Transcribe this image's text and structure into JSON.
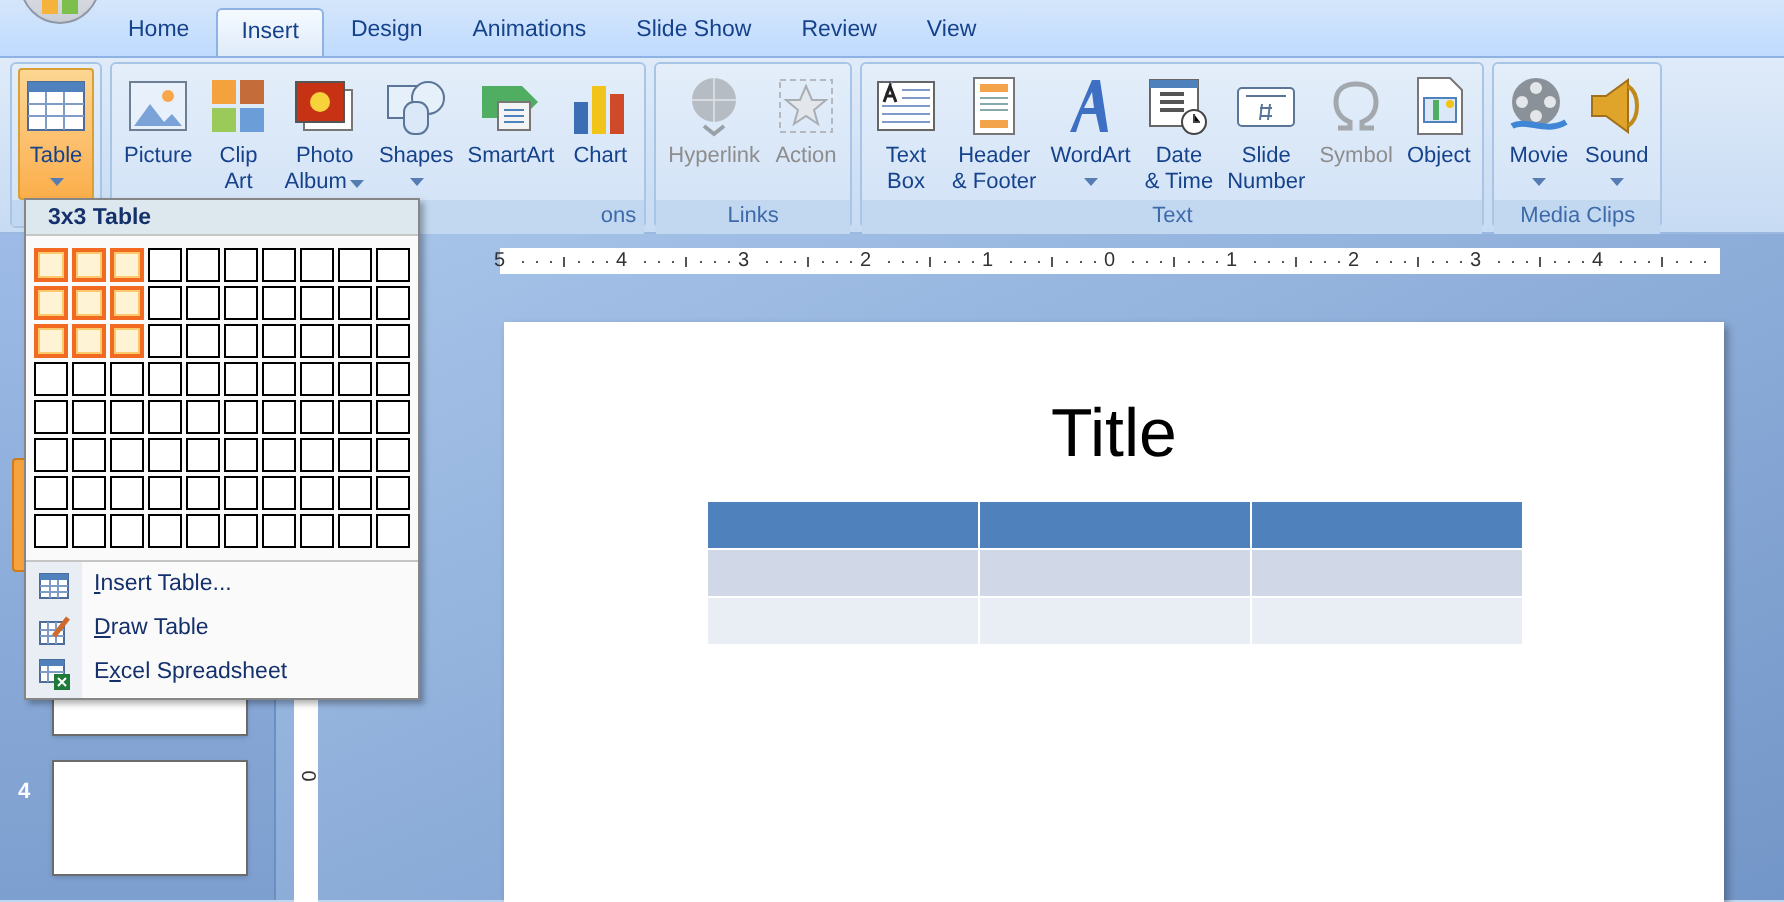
{
  "tabs": [
    {
      "label": "Home",
      "selected": false
    },
    {
      "label": "Insert",
      "selected": true
    },
    {
      "label": "Design",
      "selected": false
    },
    {
      "label": "Animations",
      "selected": false
    },
    {
      "label": "Slide Show",
      "selected": false
    },
    {
      "label": "Review",
      "selected": false
    },
    {
      "label": "View",
      "selected": false
    }
  ],
  "ribbon": {
    "groups": [
      {
        "buttons": [
          {
            "lines": [
              "Table"
            ],
            "dropdown": true,
            "disabled": false,
            "selected": true
          }
        ]
      },
      {
        "label": "ons",
        "buttons": [
          {
            "lines": [
              "Picture"
            ],
            "dropdown": false,
            "disabled": false,
            "selected": false
          },
          {
            "lines": [
              "Clip",
              "Art"
            ],
            "dropdown": false,
            "disabled": false,
            "selected": false
          },
          {
            "lines": [
              "Photo",
              "Album"
            ],
            "dropdown": true,
            "disabled": false,
            "selected": false
          },
          {
            "lines": [
              "Shapes"
            ],
            "dropdown": true,
            "disabled": false,
            "selected": false
          },
          {
            "lines": [
              "SmartArt"
            ],
            "dropdown": false,
            "disabled": false,
            "selected": false
          },
          {
            "lines": [
              "Chart"
            ],
            "dropdown": false,
            "disabled": false,
            "selected": false
          }
        ]
      },
      {
        "label": "Links",
        "buttons": [
          {
            "lines": [
              "Hyperlink"
            ],
            "dropdown": false,
            "disabled": true,
            "selected": false
          },
          {
            "lines": [
              "Action"
            ],
            "dropdown": false,
            "disabled": true,
            "selected": false
          }
        ]
      },
      {
        "label": "Text",
        "buttons": [
          {
            "lines": [
              "Text",
              "Box"
            ],
            "dropdown": false,
            "disabled": false,
            "selected": false
          },
          {
            "lines": [
              "Header",
              "& Footer"
            ],
            "dropdown": false,
            "disabled": false,
            "selected": false
          },
          {
            "lines": [
              "WordArt"
            ],
            "dropdown": true,
            "disabled": false,
            "selected": false
          },
          {
            "lines": [
              "Date",
              "& Time"
            ],
            "dropdown": false,
            "disabled": false,
            "selected": false
          },
          {
            "lines": [
              "Slide",
              "Number"
            ],
            "dropdown": false,
            "disabled": false,
            "selected": false
          },
          {
            "lines": [
              "Symbol"
            ],
            "dropdown": false,
            "disabled": true,
            "selected": false
          },
          {
            "lines": [
              "Object"
            ],
            "dropdown": false,
            "disabled": false,
            "selected": false
          }
        ]
      },
      {
        "label": "Media Clips",
        "buttons": [
          {
            "lines": [
              "Movie"
            ],
            "dropdown": true,
            "disabled": false,
            "selected": false
          },
          {
            "lines": [
              "Sound"
            ],
            "dropdown": true,
            "disabled": false,
            "selected": false
          }
        ]
      }
    ]
  },
  "table_menu": {
    "header": "3x3 Table",
    "grid": [
      {
        "cells": [
          {
            "selected": true
          },
          {
            "selected": true
          },
          {
            "selected": true
          },
          {
            "selected": false
          },
          {
            "selected": false
          },
          {
            "selected": false
          },
          {
            "selected": false
          },
          {
            "selected": false
          },
          {
            "selected": false
          },
          {
            "selected": false
          }
        ]
      },
      {
        "cells": [
          {
            "selected": true
          },
          {
            "selected": true
          },
          {
            "selected": true
          },
          {
            "selected": false
          },
          {
            "selected": false
          },
          {
            "selected": false
          },
          {
            "selected": false
          },
          {
            "selected": false
          },
          {
            "selected": false
          },
          {
            "selected": false
          }
        ]
      },
      {
        "cells": [
          {
            "selected": true
          },
          {
            "selected": true
          },
          {
            "selected": true
          },
          {
            "selected": false
          },
          {
            "selected": false
          },
          {
            "selected": false
          },
          {
            "selected": false
          },
          {
            "selected": false
          },
          {
            "selected": false
          },
          {
            "selected": false
          }
        ]
      },
      {
        "cells": [
          {
            "selected": false
          },
          {
            "selected": false
          },
          {
            "selected": false
          },
          {
            "selected": false
          },
          {
            "selected": false
          },
          {
            "selected": false
          },
          {
            "selected": false
          },
          {
            "selected": false
          },
          {
            "selected": false
          },
          {
            "selected": false
          }
        ]
      },
      {
        "cells": [
          {
            "selected": false
          },
          {
            "selected": false
          },
          {
            "selected": false
          },
          {
            "selected": false
          },
          {
            "selected": false
          },
          {
            "selected": false
          },
          {
            "selected": false
          },
          {
            "selected": false
          },
          {
            "selected": false
          },
          {
            "selected": false
          }
        ]
      },
      {
        "cells": [
          {
            "selected": false
          },
          {
            "selected": false
          },
          {
            "selected": false
          },
          {
            "selected": false
          },
          {
            "selected": false
          },
          {
            "selected": false
          },
          {
            "selected": false
          },
          {
            "selected": false
          },
          {
            "selected": false
          },
          {
            "selected": false
          }
        ]
      },
      {
        "cells": [
          {
            "selected": false
          },
          {
            "selected": false
          },
          {
            "selected": false
          },
          {
            "selected": false
          },
          {
            "selected": false
          },
          {
            "selected": false
          },
          {
            "selected": false
          },
          {
            "selected": false
          },
          {
            "selected": false
          },
          {
            "selected": false
          }
        ]
      },
      {
        "cells": [
          {
            "selected": false
          },
          {
            "selected": false
          },
          {
            "selected": false
          },
          {
            "selected": false
          },
          {
            "selected": false
          },
          {
            "selected": false
          },
          {
            "selected": false
          },
          {
            "selected": false
          },
          {
            "selected": false
          },
          {
            "selected": false
          }
        ]
      }
    ],
    "items": [
      {
        "key": "I",
        "after": "nsert Table..."
      },
      {
        "key": "D",
        "after": "raw Table"
      },
      {
        "before": "E",
        "key": "x",
        "after": "cel Spreadsheet"
      }
    ]
  },
  "slides_pane": {
    "thumbnails": [
      {
        "selected": true
      },
      {
        "selected": false
      },
      {
        "number": "4",
        "selected": false
      }
    ]
  },
  "ruler": {
    "labels": [
      "5",
      "4",
      "3",
      "2",
      "1",
      "0",
      "1",
      "2",
      "3",
      "4"
    ]
  },
  "vertical_ruler": {
    "labels": [
      "0"
    ]
  },
  "slide": {
    "title": "Title",
    "table": {
      "rows": [
        {
          "kind": "header"
        },
        {
          "kind": "band"
        },
        {
          "kind": "plain"
        }
      ]
    }
  }
}
